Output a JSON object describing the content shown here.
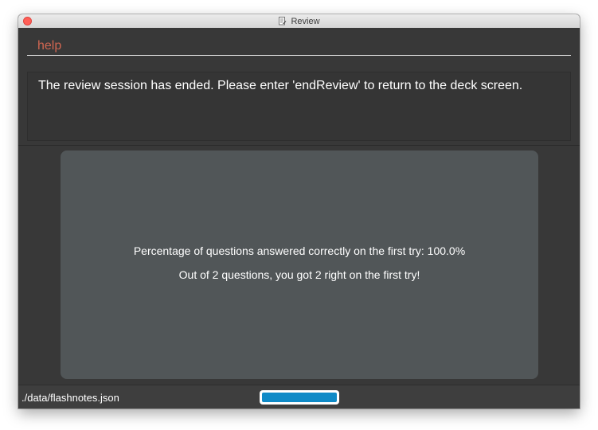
{
  "window": {
    "title": "Review"
  },
  "command": {
    "value": "help",
    "text_color": "#d06651"
  },
  "result": {
    "message": "The review session has ended. Please enter 'endReview' to return to the deck screen."
  },
  "stats": {
    "percentage_line": "Percentage of questions answered correctly on the first try: 100.0%",
    "summary_line": "Out of 2 questions, you got 2 right on the first try!"
  },
  "status": {
    "file_path": "./data/flashnotes.json",
    "progress": 1.0,
    "progress_color": "#0f8ac7"
  },
  "icons": {
    "close": "close-icon",
    "title": "document-icon"
  }
}
